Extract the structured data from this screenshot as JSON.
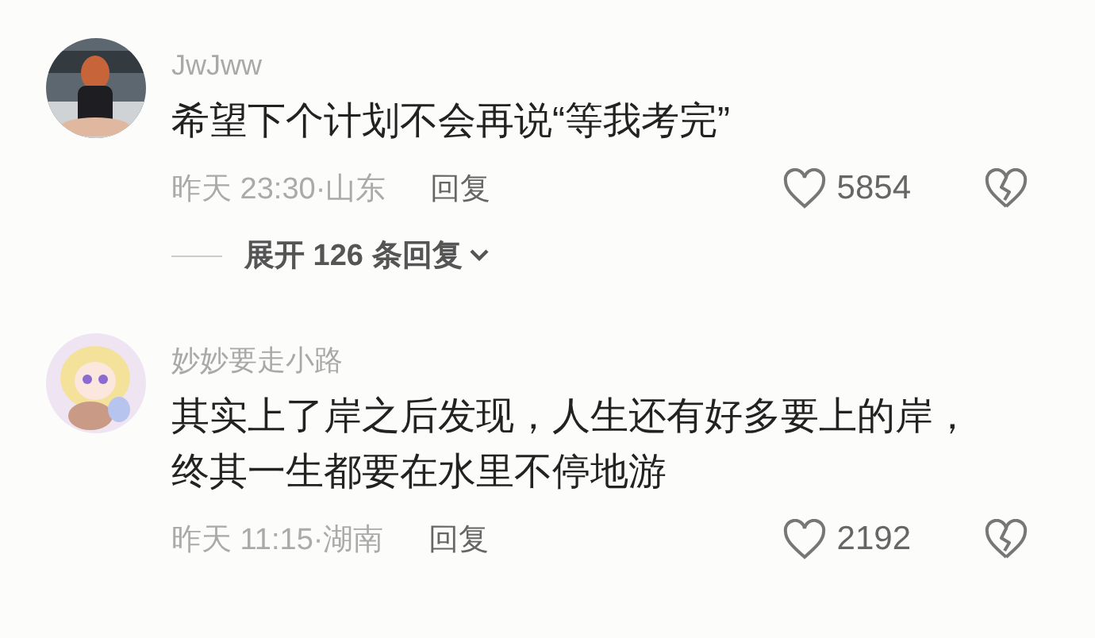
{
  "comments": [
    {
      "username": "JwJww",
      "text": "希望下个计划不会再说“等我考完”",
      "time": "昨天 23:30·山东",
      "reply": "回复",
      "likes": "5854",
      "expand": "展开 126 条回复"
    },
    {
      "username": "妙妙要走小路",
      "text": "其实上了岸之后发现，人生还有好多要上的岸，终其一生都要在水里不停地游",
      "time": "昨天 11:15·湖南",
      "reply": "回复",
      "likes": "2192"
    }
  ]
}
